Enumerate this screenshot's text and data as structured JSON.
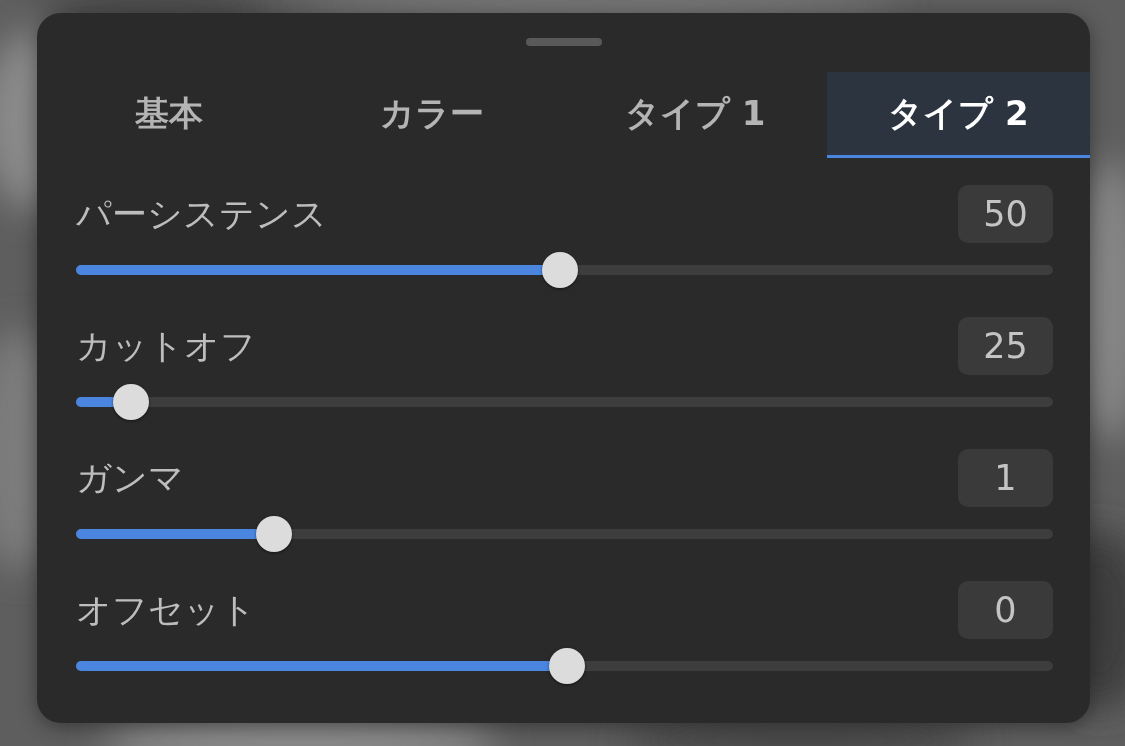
{
  "tabs": [
    {
      "label": "基本",
      "selected": false
    },
    {
      "label": "カラー",
      "selected": false
    },
    {
      "label": "タイプ 1",
      "selected": false
    },
    {
      "label": "タイプ 2",
      "selected": true
    }
  ],
  "sliders": [
    {
      "label": "パーシステンス",
      "value": "50",
      "level": 0.495
    },
    {
      "label": "カットオフ",
      "value": "25",
      "level": 0.056
    },
    {
      "label": "ガンマ",
      "value": "1",
      "level": 0.203
    },
    {
      "label": "オフセット",
      "value": "0",
      "level": 0.503
    }
  ]
}
